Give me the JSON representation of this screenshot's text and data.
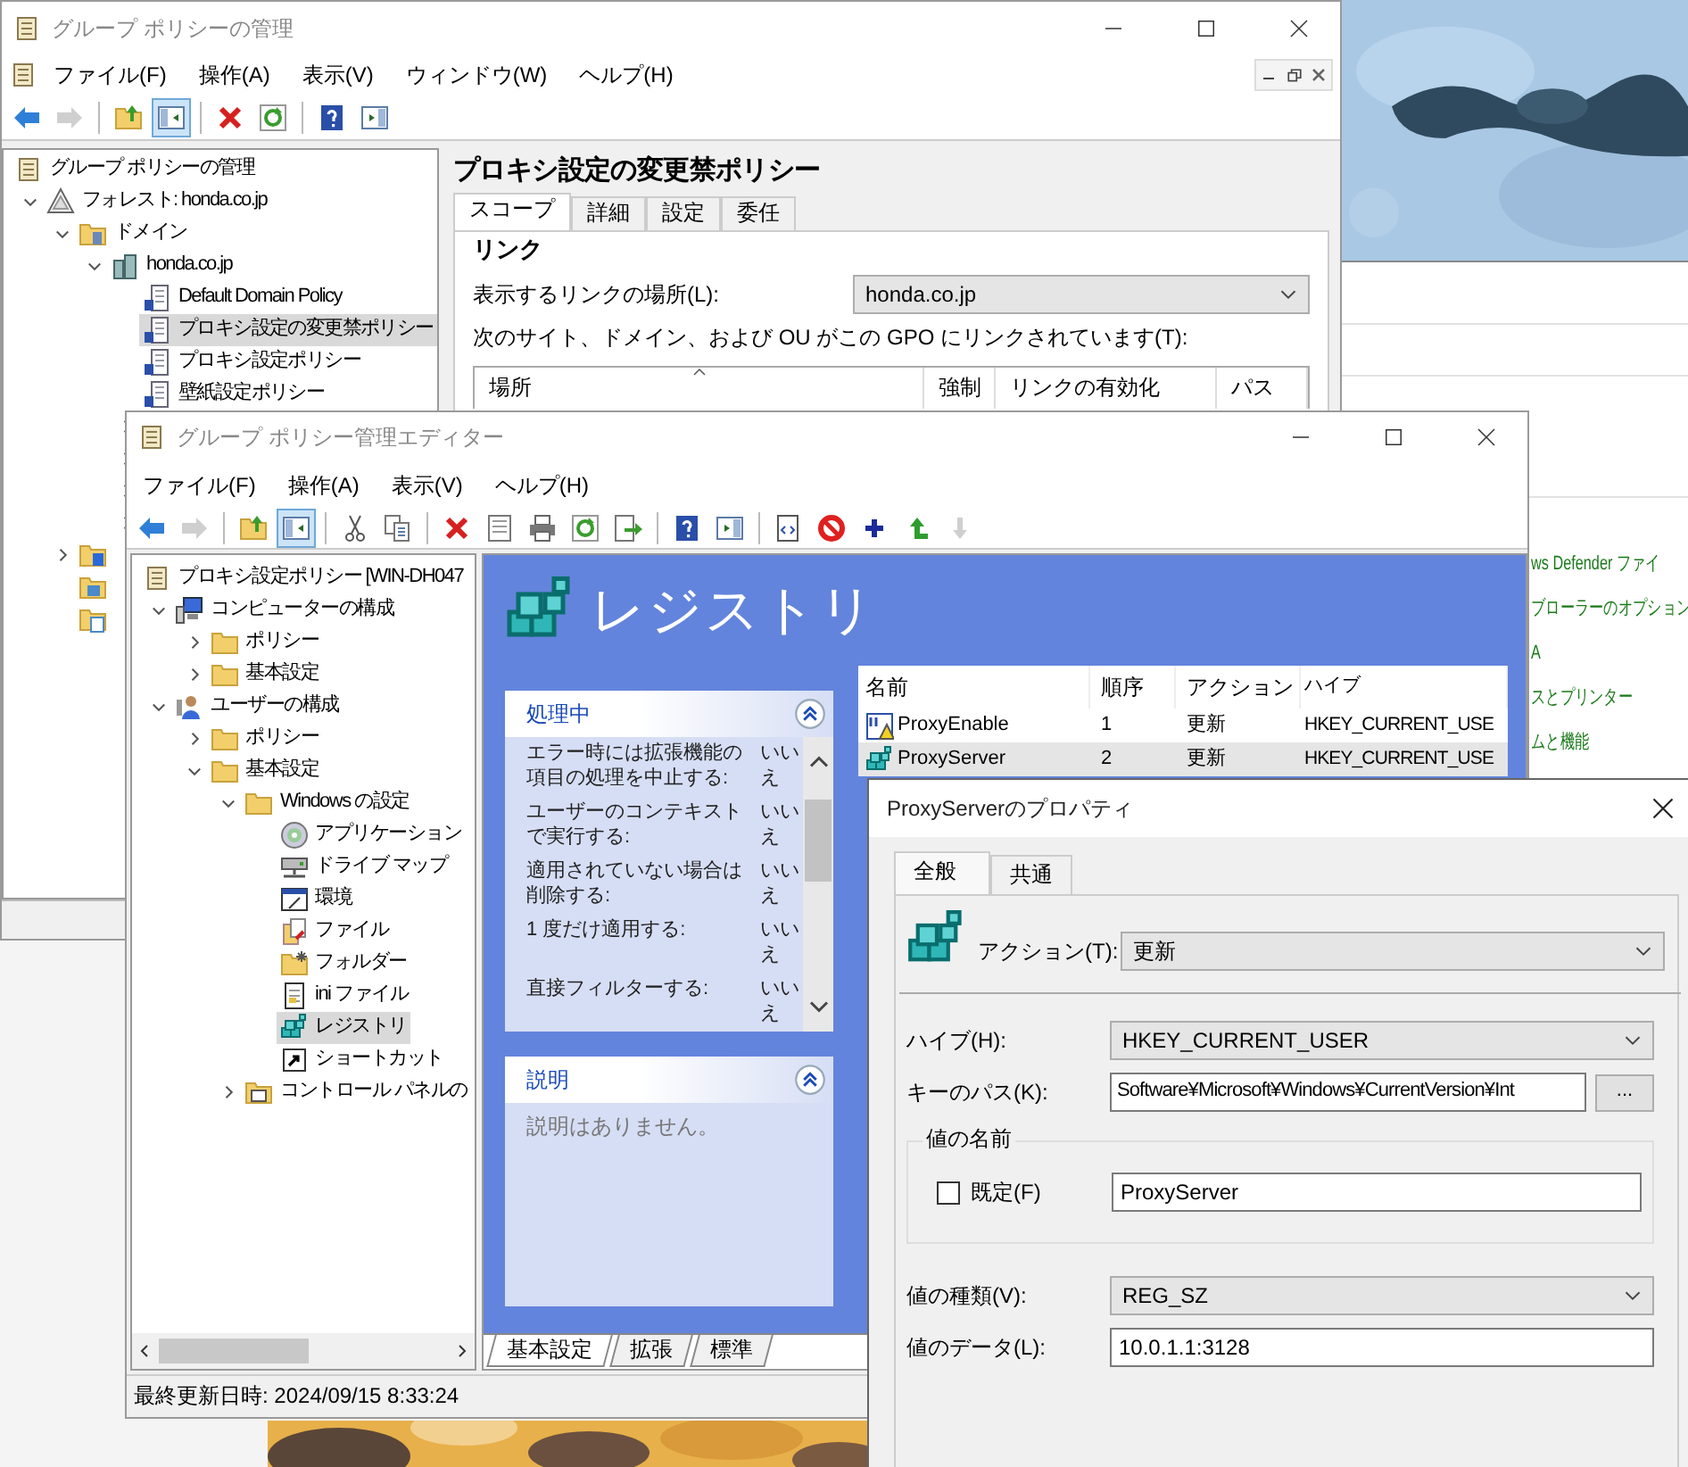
{
  "background_window": {
    "links": [
      "ws Defender ファイ",
      "ブローラーのオプション",
      "A",
      "スとプリンター",
      "ムと機能"
    ]
  },
  "gpmc": {
    "title": "グループ ポリシーの管理",
    "menu": [
      "ファイル(F)",
      "操作(A)",
      "表示(V)",
      "ウィンドウ(W)",
      "ヘルプ(H)"
    ],
    "toolbar": [
      [
        {
          "kind": "back",
          "pressed": false,
          "disabled": false
        },
        {
          "kind": "forward",
          "pressed": false,
          "disabled": true
        }
      ],
      [
        {
          "kind": "up",
          "pressed": false,
          "disabled": false
        },
        {
          "kind": "tree",
          "pressed": true,
          "disabled": false
        }
      ],
      [
        {
          "kind": "delete",
          "pressed": false,
          "disabled": false
        },
        {
          "kind": "refresh",
          "pressed": false,
          "disabled": false
        }
      ],
      [
        {
          "kind": "help",
          "pressed": false,
          "disabled": false
        },
        {
          "kind": "action",
          "pressed": false,
          "disabled": false
        }
      ]
    ],
    "tree": [
      {
        "label": "グループ ポリシーの管理",
        "kind": "gpmc",
        "selected": false,
        "children": [
          {
            "label": "フォレスト: honda.co.jp",
            "kind": "forest",
            "selected": false,
            "expanded": true,
            "children": [
              {
                "label": "ドメイン",
                "kind": "domains",
                "selected": false,
                "expanded": true,
                "children": [
                  {
                    "label": "honda.co.jp",
                    "kind": "domain",
                    "selected": false,
                    "expanded": true,
                    "children": [
                      {
                        "label": "Default Domain Policy",
                        "kind": "gpo",
                        "selected": false
                      },
                      {
                        "label": "プロキシ設定の変更禁ポリシー",
                        "kind": "gpo",
                        "selected": true
                      },
                      {
                        "label": "プロキシ設定ポリシー",
                        "kind": "gpo",
                        "selected": false
                      },
                      {
                        "label": "壁紙設定ポリシー",
                        "kind": "gpo",
                        "selected": false
                      }
                    ]
                  }
                ]
              },
              {
                "kind": "site",
                "selected": false,
                "expanded": false
              },
              {
                "kind": "modeling",
                "selected": false
              },
              {
                "kind": "results",
                "selected": false
              }
            ]
          }
        ]
      }
    ],
    "detail": {
      "title": "プロキシ設定の変更禁ポリシー",
      "tabs": [
        {
          "label": "スコープ",
          "selected": true
        },
        {
          "label": "詳細",
          "selected": false
        },
        {
          "label": "設定",
          "selected": false
        },
        {
          "label": "委任",
          "selected": false
        }
      ],
      "section": "リンク",
      "location_label": "表示するリンクの場所(L):",
      "location_value": "honda.co.jp",
      "links_label": "次のサイト、ドメイン、および OU がこの GPO にリンクされています(T):",
      "columns": [
        {
          "label": "場所",
          "sorted": true
        },
        {
          "label": "強制",
          "sorted": false
        },
        {
          "label": "リンクの有効化",
          "sorted": false
        },
        {
          "label": "パス",
          "sorted": false
        }
      ]
    }
  },
  "editor": {
    "title": "グループ ポリシー管理エディター",
    "menu": [
      "ファイル(F)",
      "操作(A)",
      "表示(V)",
      "ヘルプ(H)"
    ],
    "toolbar": [
      [
        {
          "kind": "back",
          "pressed": false,
          "disabled": false
        },
        {
          "kind": "forward",
          "pressed": false,
          "disabled": true
        }
      ],
      [
        {
          "kind": "up",
          "pressed": false,
          "disabled": false
        },
        {
          "kind": "tree",
          "pressed": true,
          "disabled": false
        }
      ],
      [
        {
          "kind": "cut",
          "pressed": false,
          "disabled": false
        },
        {
          "kind": "copy",
          "pressed": false,
          "disabled": false
        }
      ],
      [
        {
          "kind": "delete",
          "pressed": false,
          "disabled": false
        },
        {
          "kind": "props",
          "pressed": false,
          "disabled": false
        },
        {
          "kind": "print",
          "pressed": false,
          "disabled": false
        },
        {
          "kind": "refresh",
          "pressed": false,
          "disabled": false
        },
        {
          "kind": "export",
          "pressed": false,
          "disabled": false
        }
      ],
      [
        {
          "kind": "help",
          "pressed": false,
          "disabled": false
        },
        {
          "kind": "action",
          "pressed": false,
          "disabled": false
        }
      ],
      [
        {
          "kind": "xml",
          "pressed": false,
          "disabled": false
        },
        {
          "kind": "stop",
          "pressed": false,
          "disabled": false
        },
        {
          "kind": "plus",
          "pressed": false,
          "disabled": false
        },
        {
          "kind": "moveup",
          "pressed": false,
          "disabled": false
        },
        {
          "kind": "movedown",
          "pressed": false,
          "disabled": true
        }
      ]
    ],
    "tree": [
      {
        "label": "プロキシ設定ポリシー [WIN-DH047",
        "kind": "gpmc",
        "selected": false,
        "children": [
          {
            "label": "コンピューターの構成",
            "kind": "computer",
            "selected": false,
            "expanded": true,
            "children": [
              {
                "label": "ポリシー",
                "kind": "folder",
                "selected": false,
                "expanded": false
              },
              {
                "label": "基本設定",
                "kind": "folder",
                "selected": false,
                "expanded": false
              }
            ]
          },
          {
            "label": "ユーザーの構成",
            "kind": "user",
            "selected": false,
            "expanded": true,
            "children": [
              {
                "label": "ポリシー",
                "kind": "folder",
                "selected": false,
                "expanded": false
              },
              {
                "label": "基本設定",
                "kind": "folder",
                "selected": false,
                "expanded": true,
                "children": [
                  {
                    "label": "Windows の設定",
                    "kind": "folder",
                    "selected": false,
                    "expanded": true,
                    "children": [
                      {
                        "label": "アプリケーション",
                        "kind": "app",
                        "selected": false
                      },
                      {
                        "label": "ドライブ マップ",
                        "kind": "drive",
                        "selected": false
                      },
                      {
                        "label": "環境",
                        "kind": "env",
                        "selected": false
                      },
                      {
                        "label": "ファイル",
                        "kind": "file",
                        "selected": false
                      },
                      {
                        "label": "フォルダー",
                        "kind": "newfolder",
                        "selected": false
                      },
                      {
                        "label": "ini ファイル",
                        "kind": "ini",
                        "selected": false
                      },
                      {
                        "label": "レジストリ",
                        "kind": "registry",
                        "selected": true
                      },
                      {
                        "label": "ショートカット",
                        "kind": "shortcut",
                        "selected": false
                      }
                    ]
                  },
                  {
                    "label": "コントロール パネルの",
                    "kind": "cpanel",
                    "selected": false,
                    "expanded": false
                  }
                ]
              }
            ]
          }
        ]
      }
    ],
    "heading": "レジストリ",
    "processing": {
      "title": "処理中",
      "rows": [
        {
          "label": "エラー時には拡張機能の項目の処理を中止する:",
          "value": "いいえ"
        },
        {
          "label": "ユーザーのコンテキストで実行する:",
          "value": "いいえ"
        },
        {
          "label": "適用されていない場合は削除する:",
          "value": "いいえ"
        },
        {
          "label": "1 度だけ適用する:",
          "value": "いいえ"
        },
        {
          "label": "直接フィルターする:",
          "value": "いいえ"
        }
      ]
    },
    "description": {
      "title": "説明",
      "text": "説明はありません。"
    },
    "table": {
      "columns": [
        "名前",
        "順序",
        "アクション",
        "ハイブ"
      ],
      "rows": [
        {
          "name": "ProxyEnable",
          "kind": "dword",
          "order": "1",
          "action": "更新",
          "hive": "HKEY_CURRENT_USE",
          "selected": false
        },
        {
          "name": "ProxyServer",
          "kind": "string",
          "order": "2",
          "action": "更新",
          "hive": "HKEY_CURRENT_USE",
          "selected": true
        }
      ]
    },
    "bottom_tabs": [
      {
        "label": "基本設定",
        "selected": true
      },
      {
        "label": "拡張",
        "selected": false
      },
      {
        "label": "標準",
        "selected": false
      }
    ],
    "status": "最終更新日時: 2024/09/15 8:33:24"
  },
  "dialog": {
    "title": "ProxyServerのプロパティ",
    "tabs": [
      {
        "label": "全般",
        "selected": true
      },
      {
        "label": "共通",
        "selected": false
      }
    ],
    "action_label": "アクション(T):",
    "action_value": "更新",
    "hive_label": "ハイブ(H):",
    "hive_value": "HKEY_CURRENT_USER",
    "key_label": "キーのパス(K):",
    "key_value": "Software¥Microsoft¥Windows¥CurrentVersion¥Int",
    "browse_button": "...",
    "value_name_group": "値の名前",
    "default_label": "既定(F)",
    "default_checked": false,
    "value_name": "ProxyServer",
    "type_label": "値の種類(V):",
    "type_value": "REG_SZ",
    "data_label": "値のデータ(L):",
    "data_value": "10.0.1.1:3128"
  }
}
